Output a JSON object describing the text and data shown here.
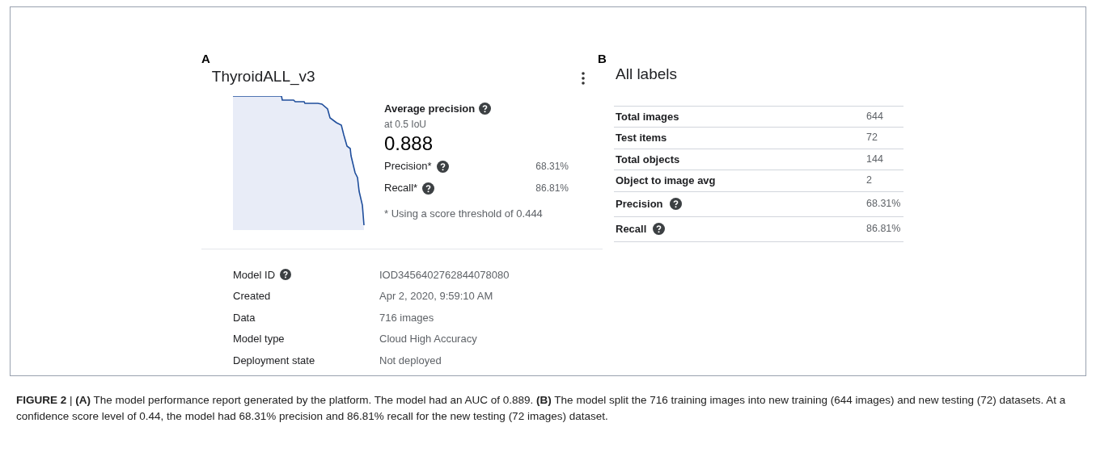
{
  "panel_a": {
    "letter": "A",
    "title": "ThyroidALL_v3",
    "metrics": {
      "heading": "Average precision",
      "subheading": "at 0.5 IoU",
      "value": "0.888",
      "rows": [
        {
          "label": "Precision*",
          "value": "68.31%"
        },
        {
          "label": "Recall*",
          "value": "86.81%"
        }
      ],
      "note": "* Using a score threshold of 0.444"
    },
    "details": [
      {
        "label": "Model ID",
        "help": true,
        "value": "IOD3456402762844078080"
      },
      {
        "label": "Created",
        "help": false,
        "value": "Apr 2, 2020, 9:59:10 AM"
      },
      {
        "label": "Data",
        "help": false,
        "value": "716 images"
      },
      {
        "label": "Model type",
        "help": false,
        "value": "Cloud High Accuracy"
      },
      {
        "label": "Deployment state",
        "help": false,
        "value": "Not deployed"
      }
    ]
  },
  "panel_b": {
    "letter": "B",
    "title": "All labels",
    "rows": [
      {
        "label": "Total images",
        "help": false,
        "value": "644"
      },
      {
        "label": "Test items",
        "help": false,
        "value": "72"
      },
      {
        "label": "Total objects",
        "help": false,
        "value": "144"
      },
      {
        "label": "Object to image avg",
        "help": false,
        "value": "2"
      },
      {
        "label": "Precision",
        "help": true,
        "value": "68.31%"
      },
      {
        "label": "Recall",
        "help": true,
        "value": "86.81%"
      }
    ]
  },
  "caption": "**FIGURE 2** | **(A)** The model performance report generated by the platform. The model had an AUC of 0.889. **(B)** The model split the 716 training images into new training (644 images) and new testing (72) datasets. At a confidence score level of 0.44, the model had 68.31% precision and 86.81% recall for the new testing (72 images) dataset."
}
